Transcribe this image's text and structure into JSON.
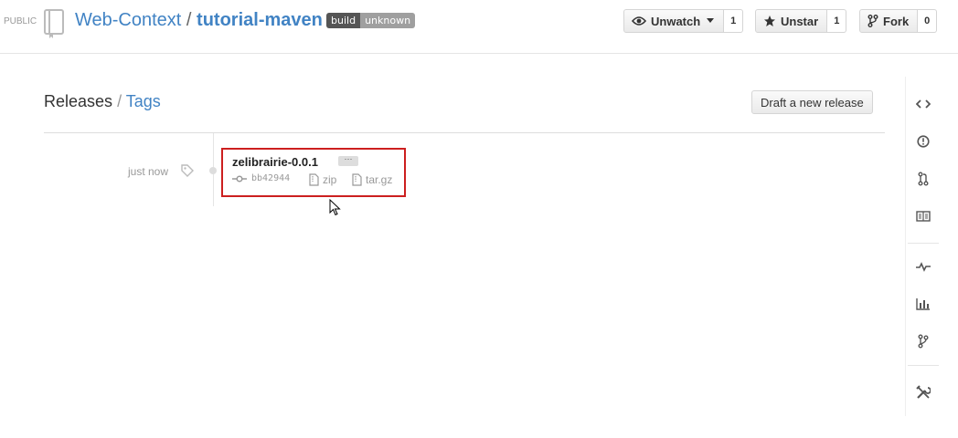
{
  "header": {
    "visibility": "PUBLIC",
    "owner": "Web-Context",
    "separator": "/",
    "repo": "tutorial-maven",
    "badge": {
      "label": "build",
      "status": "unknown"
    },
    "actions": [
      {
        "name": "watch",
        "label": "Unwatch",
        "count": "1",
        "icon": "eye-icon"
      },
      {
        "name": "star",
        "label": "Unstar",
        "count": "1",
        "icon": "star-icon"
      },
      {
        "name": "fork",
        "label": "Fork",
        "count": "0",
        "icon": "fork-icon"
      }
    ]
  },
  "releases": {
    "title": "Releases",
    "separator": "/",
    "tags_link": "Tags",
    "draft_button": "Draft a new release",
    "items": [
      {
        "when": "just now",
        "tag": "zelibrairie-0.0.1",
        "more": "···",
        "commit": "bb42944",
        "zip": "zip",
        "tar": "tar.gz"
      }
    ]
  },
  "sidebar": {
    "icons": [
      "code-icon",
      "issues-icon",
      "pull-request-icon",
      "wiki-icon",
      "pulse-icon",
      "graphs-icon",
      "network-icon",
      "settings-icon"
    ]
  },
  "colors": {
    "link": "#4183c4",
    "highlight": "#cc1f1f"
  }
}
